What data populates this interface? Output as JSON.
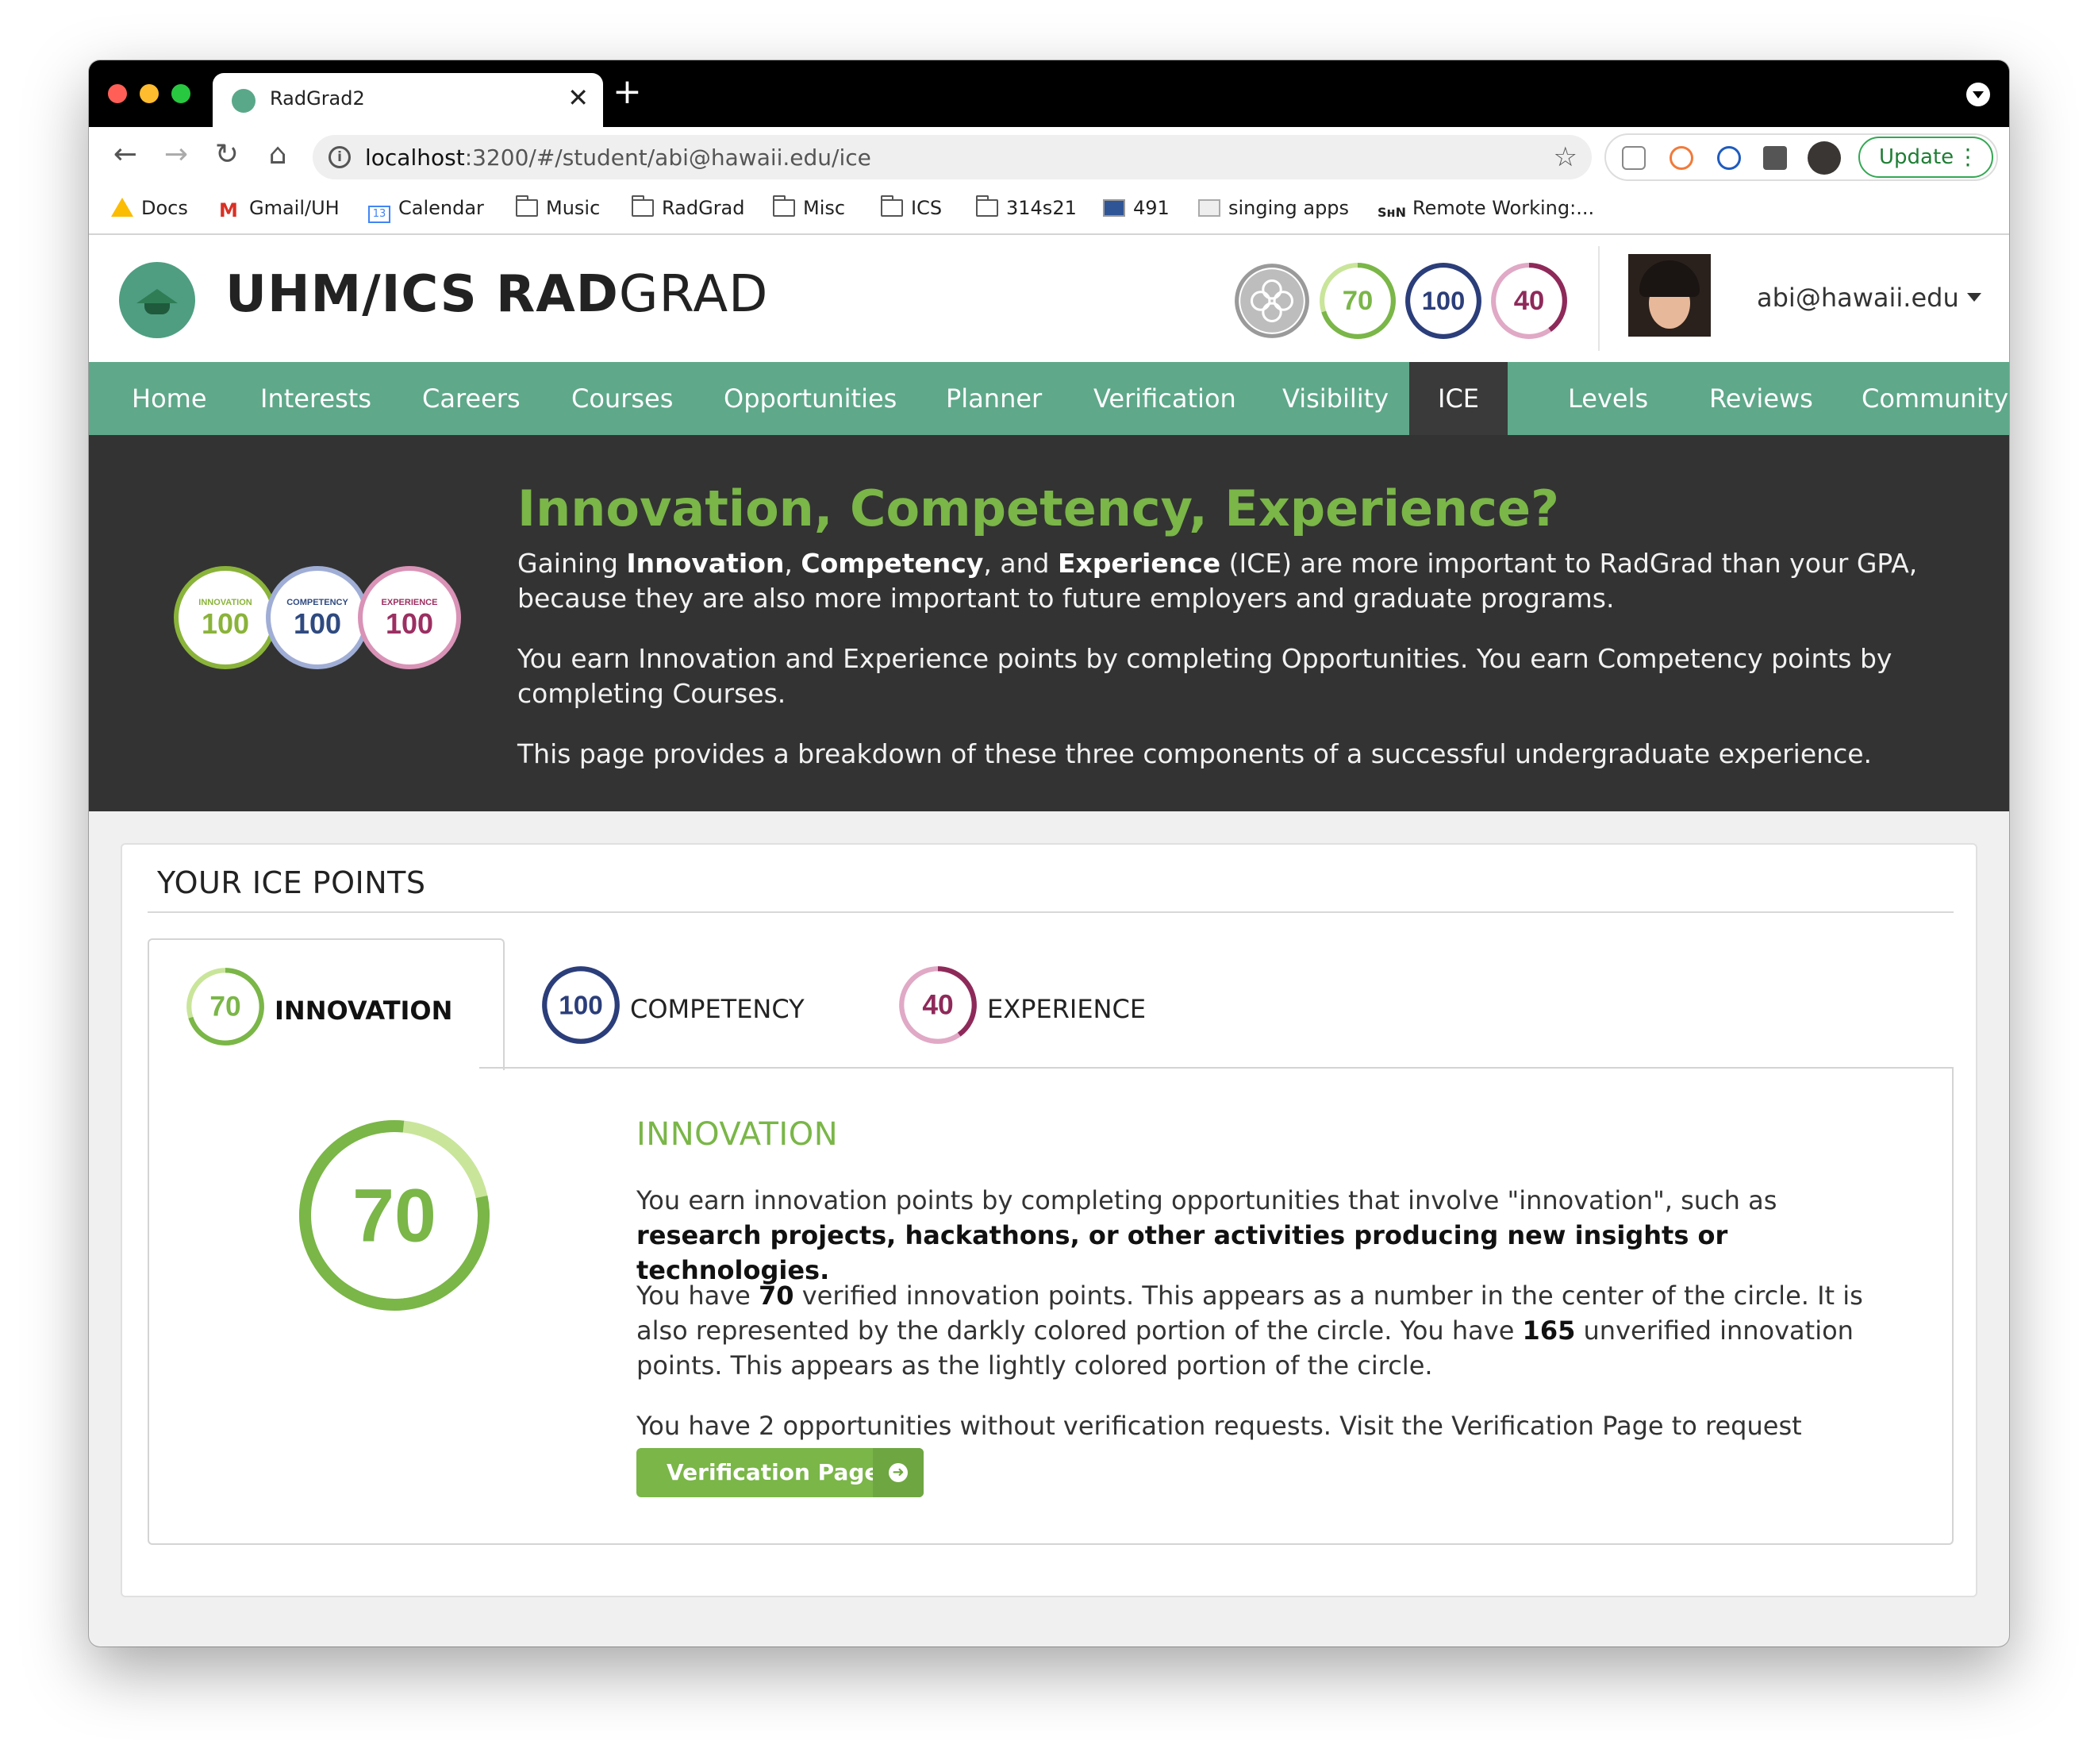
{
  "browser": {
    "tab_title": "RadGrad2",
    "url_host": "localhost",
    "url_rest": ":3200/#/student/abi@hawaii.edu/ice",
    "update_label": "Update",
    "bookmarks": [
      "Docs",
      "Gmail/UH",
      "Calendar",
      "Music",
      "RadGrad",
      "Misc",
      "ICS",
      "314s21",
      "491",
      "singing apps",
      "Remote Working:..."
    ],
    "calendar_icon_text": "13",
    "swn_icon_text": "SʜN"
  },
  "header": {
    "title_bold": "UHM/ICS RAD",
    "title_light": "GRAD",
    "badges": {
      "innovation": "70",
      "competency": "100",
      "experience": "40"
    },
    "user_email": "abi@hawaii.edu"
  },
  "nav": {
    "items": [
      "Home",
      "Interests",
      "Careers",
      "Courses",
      "Opportunities",
      "Planner",
      "Verification",
      "Visibility",
      "ICE",
      "Levels",
      "Reviews",
      "Community"
    ],
    "active": "ICE"
  },
  "hero": {
    "heading": "Innovation, Competency, Experience?",
    "p1_a": "Gaining ",
    "p1_b1": "Innovation",
    "p1_c": ", ",
    "p1_b2": "Competency",
    "p1_d": ", and ",
    "p1_b3": "Experience",
    "p1_e": " (ICE) are more important to RadGrad than your GPA, because they are also more important to future employers and graduate programs.",
    "p2": "You earn Innovation and Experience points by completing Opportunities. You earn Competency points by completing Courses.",
    "p3": "This page provides a breakdown of these three components of a successful undergraduate experience.",
    "badges": [
      {
        "label": "INNOVATION",
        "value": "100",
        "color": "#8ab33a"
      },
      {
        "label": "COMPETENCY",
        "value": "100",
        "color": "#2f4a80"
      },
      {
        "label": "EXPERIENCE",
        "value": "100",
        "color": "#9c2f62"
      }
    ]
  },
  "ice_points": {
    "title": "YOUR ICE POINTS",
    "tabs": [
      {
        "value": "70",
        "label": "INNOVATION",
        "color": "#7ab648",
        "light": "#c9e59a",
        "fraction": 0.7
      },
      {
        "value": "100",
        "label": "COMPETENCY",
        "color": "#2b3e7a",
        "light": "#a9b6d8",
        "fraction": 1.0
      },
      {
        "value": "40",
        "label": "EXPERIENCE",
        "color": "#8e2a5a",
        "light": "#e0a9c5",
        "fraction": 0.4
      }
    ],
    "active_tab": "INNOVATION",
    "panel": {
      "value": "70",
      "verified": 70,
      "unverified": 165,
      "heading": "INNOVATION",
      "p1_a": "You earn innovation points by completing opportunities that involve \"innovation\", such as ",
      "p1_b": "research projects, hackathons, or other activities producing new insights or technologies.",
      "p2_a": "You have ",
      "p2_b": "70",
      "p2_c": " verified innovation points. This appears as a number in the center of the circle. It is also represented by the darkly colored portion of the circle. You have ",
      "p2_d": "165",
      "p2_e": " unverified innovation points. This appears as the lightly colored portion of the circle.",
      "p3": "You have 2 opportunities without verification requests. Visit the Verification Page to request verification.",
      "button_label": "Verification Page"
    }
  },
  "colors": {
    "nav_green": "#5fa88a",
    "hero_bg": "#333333",
    "accent_green": "#7ab648"
  }
}
